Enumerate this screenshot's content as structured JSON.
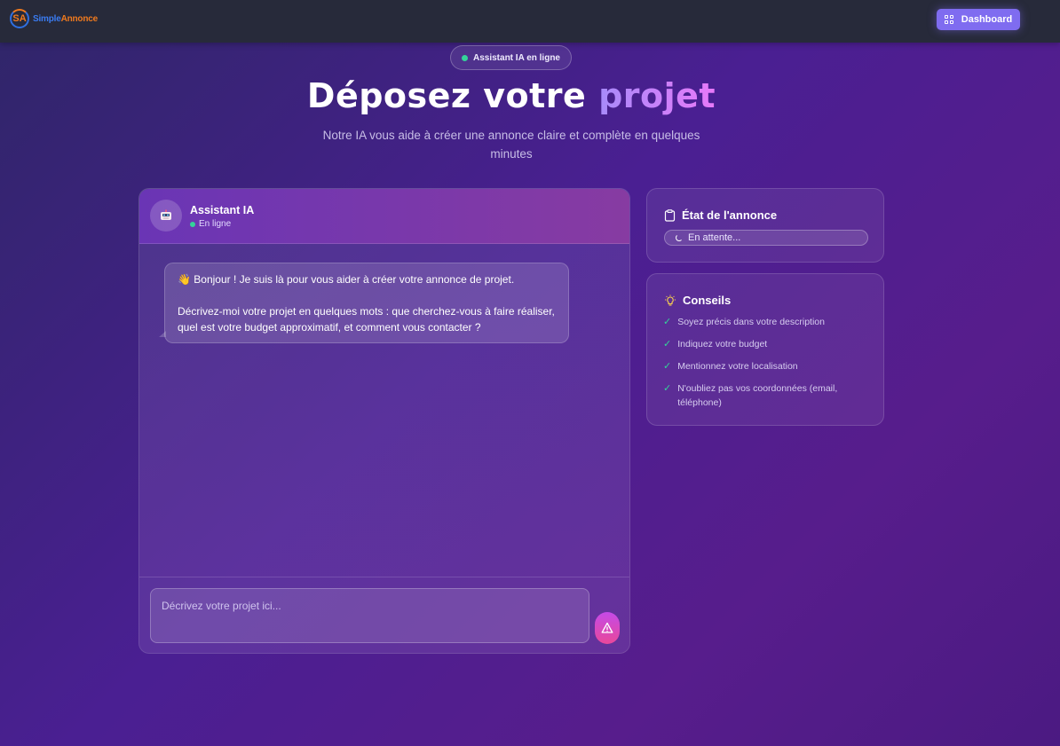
{
  "header": {
    "logo_mark": "SA",
    "logo_simple": "Simple",
    "logo_annonce": "Annonce",
    "dashboard_label": "Dashboard"
  },
  "hero": {
    "status_pill": "Assistant IA en ligne",
    "title_main": "Déposez votre",
    "title_accent": "projet",
    "subtitle": "Notre IA vous aide à créer une annonce claire et complète en quelques minutes"
  },
  "chat": {
    "assistant_name": "Assistant IA",
    "assistant_status": "En ligne",
    "message_line1": "👋 Bonjour ! Je suis là pour vous aider à créer votre annonce de projet.",
    "message_line2": "Décrivez-moi votre projet en quelques mots : que cherchez-vous à faire réaliser, quel est votre budget approximatif, et comment vous contacter ?",
    "input_placeholder": "Décrivez votre projet ici..."
  },
  "status_card": {
    "title": "État de l'annonce",
    "value": "En attente..."
  },
  "tips_card": {
    "title": "Conseils",
    "items": [
      "Soyez précis dans votre description",
      "Indiquez votre budget",
      "Mentionnez votre localisation",
      "N'oubliez pas vos coordonnées (email, téléphone)"
    ]
  },
  "colors": {
    "accent": "#7f6cf0",
    "online": "#34d399",
    "send_gradient_start": "#c44ae8",
    "send_gradient_end": "#e9489a"
  },
  "icons": {
    "dashboard": "grid-icon",
    "avatar": "robot-icon",
    "send": "send-icon",
    "status": "clipboard-icon",
    "tips": "lightbulb-icon",
    "tip_item": "check-icon"
  }
}
